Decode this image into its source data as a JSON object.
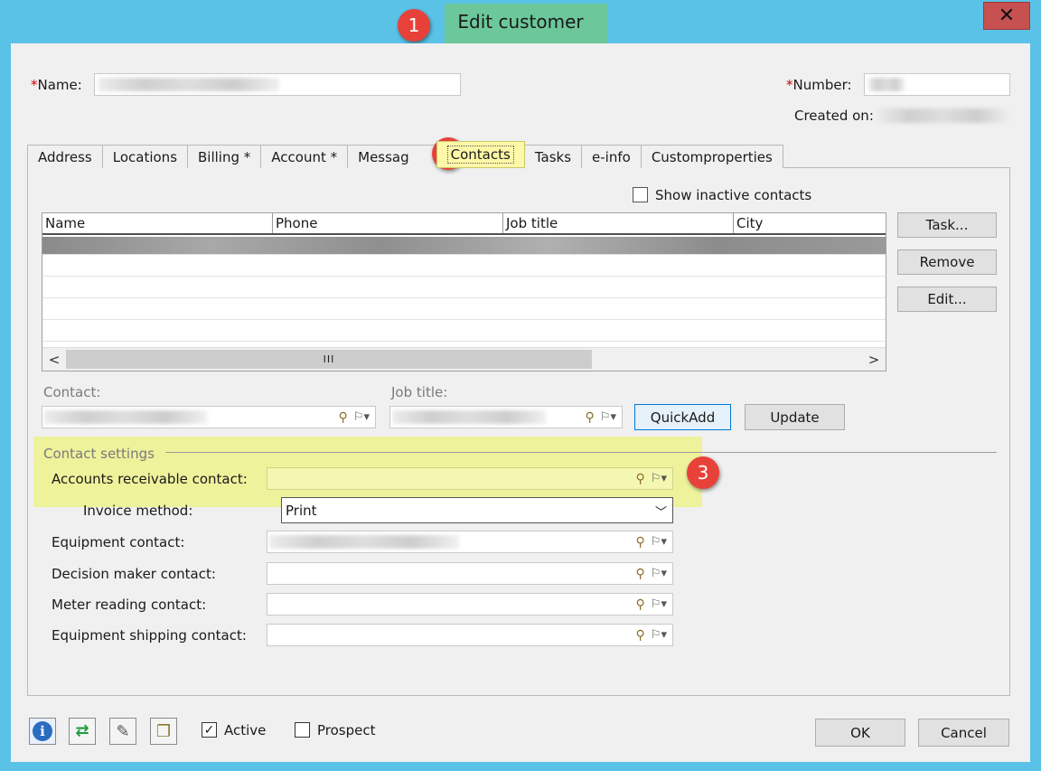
{
  "window": {
    "title": "Edit customer",
    "close_glyph": "✕"
  },
  "annotations": [
    "1",
    "2",
    "3"
  ],
  "header": {
    "name_label": "Name:",
    "number_label": "Number:",
    "created_on_label": "Created on:",
    "required_marker": "*"
  },
  "tabs": [
    {
      "label": "Address"
    },
    {
      "label": "Locations"
    },
    {
      "label": "Billing  *"
    },
    {
      "label": "Account *"
    },
    {
      "label": "Messag"
    },
    {
      "label": "Contacts"
    },
    {
      "label": "Tasks"
    },
    {
      "label": "e-info"
    },
    {
      "label": "Customproperties"
    }
  ],
  "contacts": {
    "show_inactive_label": "Show inactive contacts",
    "columns": [
      "Name",
      "Phone",
      "Job title",
      "City"
    ],
    "scroll_thumb_glyph": "III",
    "scroll_left_glyph": "<",
    "scroll_right_glyph": ">",
    "side_buttons": {
      "task": "Task...",
      "remove": "Remove",
      "edit": "Edit..."
    },
    "contact_label": "Contact:",
    "job_title_label": "Job title:",
    "quickadd": "QuickAdd",
    "update": "Update"
  },
  "settings": {
    "group_label": "Contact settings",
    "ar_contact_label": "Accounts receivable contact:",
    "invoice_method_label": "Invoice method:",
    "invoice_method_value": "Print",
    "equipment_contact_label": "Equipment contact:",
    "decision_maker_label": "Decision maker contact:",
    "meter_reading_label": "Meter reading contact:",
    "equipment_shipping_label": "Equipment shipping contact:"
  },
  "footer": {
    "active_label": "Active",
    "active_checked": true,
    "prospect_label": "Prospect",
    "prospect_checked": false,
    "ok": "OK",
    "cancel": "Cancel",
    "icons": [
      "info-icon",
      "swap-icon",
      "attachment-icon",
      "copy-icon"
    ]
  },
  "colors": {
    "frame": "#5bc2e7",
    "highlight_yellow": "#eef29b",
    "badge_red": "#e8413a",
    "title_green": "#6cc79a"
  }
}
